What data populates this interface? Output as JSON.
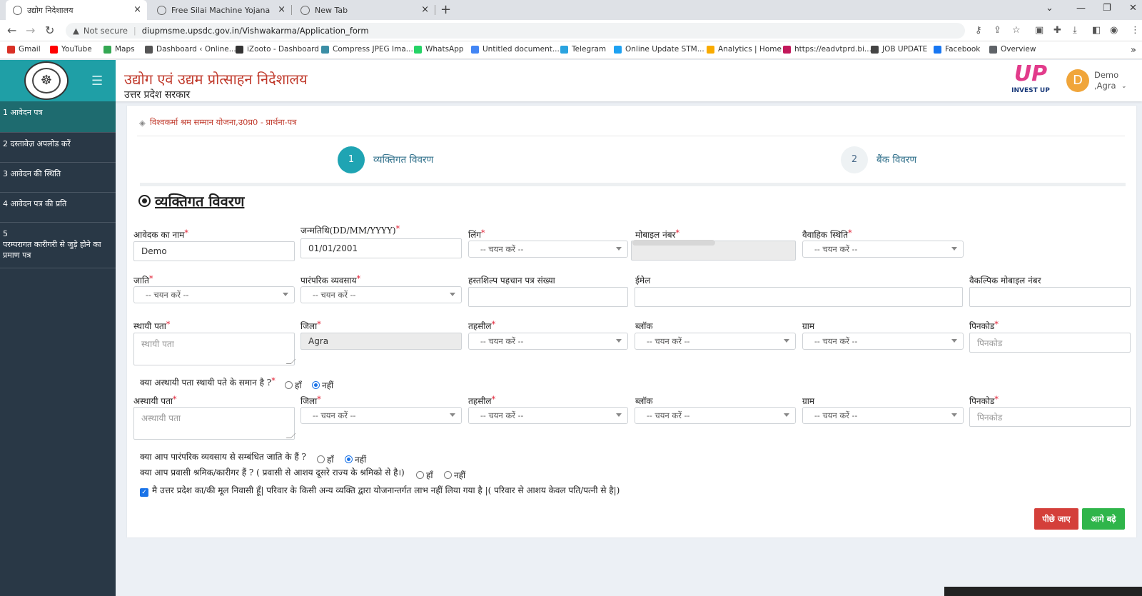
{
  "browser": {
    "tabs": [
      {
        "title": "उद्योग निदेशालय",
        "active": true
      },
      {
        "title": "Free Silai Machine Yojana",
        "active": false
      },
      {
        "title": "New Tab",
        "active": false
      }
    ],
    "new_tab_symbol": "+",
    "close_symbol": "×",
    "security_label": "Not secure",
    "url": "diupmsme.upsdc.gov.in/Vishwakarma/Application_form",
    "bookmarks": [
      {
        "label": "Gmail",
        "color": "#d93025"
      },
      {
        "label": "YouTube",
        "color": "#ff0000"
      },
      {
        "label": "Maps",
        "color": "#34a853"
      },
      {
        "label": "Dashboard ‹ Online...",
        "color": "#555555"
      },
      {
        "label": "iZooto - Dashboard",
        "color": "#333333"
      },
      {
        "label": "Compress JPEG Ima...",
        "color": "#3b8ea5"
      },
      {
        "label": "WhatsApp",
        "color": "#25d366"
      },
      {
        "label": "Untitled document...",
        "color": "#4285f4"
      },
      {
        "label": "Telegram",
        "color": "#2aa3df"
      },
      {
        "label": "Online Update STM...",
        "color": "#1da1f2"
      },
      {
        "label": "Analytics | Home",
        "color": "#f9ab00"
      },
      {
        "label": "https://eadvtprd.bi...",
        "color": "#c2185b"
      },
      {
        "label": "JOB UPDATE",
        "color": "#444444"
      },
      {
        "label": "Facebook",
        "color": "#1877f2"
      },
      {
        "label": "Overview",
        "color": "#5f6368"
      }
    ],
    "more_bookmarks": "»"
  },
  "header": {
    "title_hindi": "उद्योग एवं उद्यम प्रोत्साहन निदेशालय",
    "subtitle_hindi": "उत्तर प्रदेश सरकार",
    "invest_up_logo": "UP",
    "invest_up_text": "INVEST UP",
    "avatar_letter": "D",
    "user_name": "Demo",
    "user_district": ",Agra"
  },
  "sidebar": {
    "items": [
      {
        "label": "1 आवेदन पत्र",
        "active": true
      },
      {
        "label": "2 दस्तावेज़ अपलोड करें",
        "active": false
      },
      {
        "label": "3 आवेदन की स्थिति",
        "active": false
      },
      {
        "label": "4 आवेदन पत्र की प्रति",
        "active": false
      },
      {
        "label": "5\n परम्परागत कारीगरी से जुड़े होने का प्रमाण पत्र",
        "active": false
      }
    ]
  },
  "form": {
    "breadcrumb": "विश्वकर्मा श्रम सम्मान योजना,उ0प्र0 - प्रार्थना-पत्र",
    "steps": [
      {
        "number": "1",
        "label": "व्यक्तिगत विवरण",
        "active": true
      },
      {
        "number": "2",
        "label": "बैंक विवरण",
        "active": false
      }
    ],
    "section_title": "व्यक्तिगत विवरण",
    "required_mark": "*",
    "labels": {
      "applicant_name": "आवेदक का नाम",
      "dob": "जन्मतिथि(DD/MM/YYYY)",
      "gender": "लिंग",
      "mobile": "मोबाइल नंबर",
      "marital": "वैवाहिक स्थिति",
      "caste": "जाति",
      "trade": "पारंपरिक व्यवसाय",
      "craft_id": "हस्तशिल्प पहचान पत्र संख्या",
      "email": "ईमेल",
      "alt_mobile": "वैकल्पिक मोबाइल नंबर",
      "perm_address": "स्थायी पता",
      "district": "जिला",
      "tehsil": "तहसील",
      "block": "ब्लॉक",
      "village": "ग्राम",
      "pincode": "पिनकोड",
      "temp_address": "अस्थायी पता"
    },
    "values": {
      "applicant_name": "Demo",
      "dob": "01/01/2001",
      "perm_district": "Agra"
    },
    "placeholders": {
      "select": "-- चयन करें --",
      "perm_address": "स्थायी पता",
      "temp_address": "अस्थायी पता",
      "pincode": "पिनकोड"
    },
    "questions": {
      "same_address": "क्या अस्थायी पता स्थायी पते के समान है ?",
      "traditional_caste": "क्या आप पारंपरिक व्यवसाय से सम्बंधित जाति के हैं ?",
      "migrant": "क्या आप प्रवासी श्रमिक/कारीगर हैं ? ( प्रवासी से आशय दूसरे राज्य के श्रमिको से है।)"
    },
    "answers": {
      "same_address": "नहीं",
      "traditional_caste": "नहीं"
    },
    "yes": "हाँ",
    "no": "नहीं",
    "declaration": "मै उत्तर प्रदेश का/की मूल निवासी हूँ| परिवार के किसी अन्य व्यक्ति द्वारा योजनान्तर्गत लाभ नहीं लिया गया है |( परिवार से आशय केवल पति/पत्नी से है|)",
    "declaration_checked": true,
    "back_button": "पीछे जाए",
    "next_button": "आगे बढ़े"
  },
  "colors": {
    "brand_teal": "#1f9fa6",
    "sidebar_bg": "#293846",
    "title_red": "#c0392b",
    "back_red": "#d43f3a",
    "next_green": "#2fb54a",
    "step_active": "#1fa4b3"
  }
}
